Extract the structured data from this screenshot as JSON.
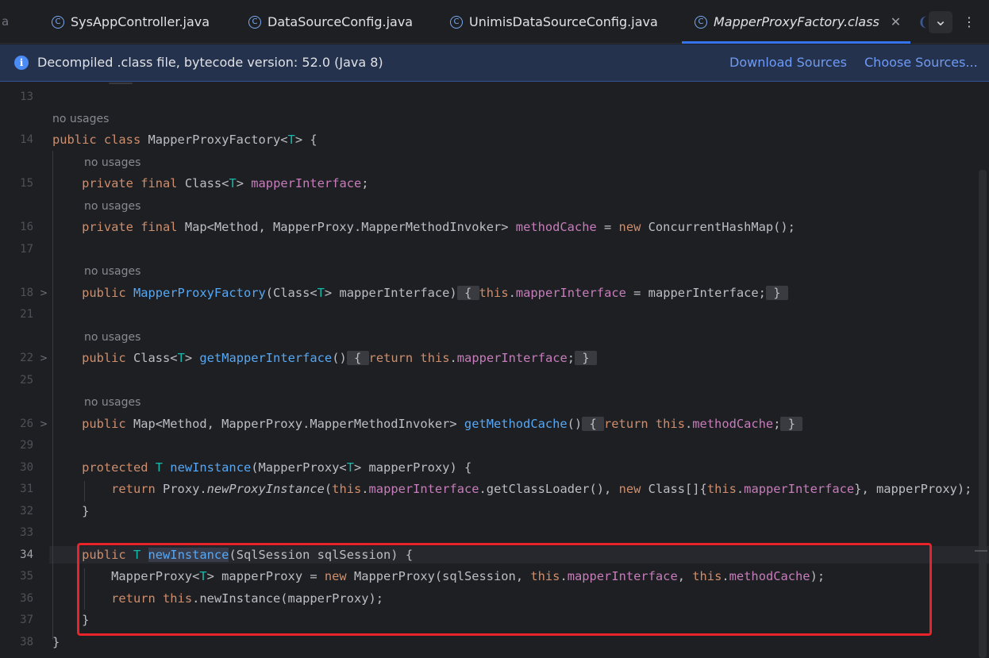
{
  "tabs": {
    "stub_left": "a",
    "items": [
      {
        "label": "SysAppController.java",
        "active": false
      },
      {
        "label": "DataSourceConfig.java",
        "active": false
      },
      {
        "label": "UnimisDataSourceConfig.java",
        "active": false
      },
      {
        "label": "MapperProxyFactory.class",
        "active": true
      }
    ],
    "class_icon_glyph": "C",
    "close_glyph": "✕",
    "overflow_glyph": "❨",
    "dropdown_glyph": "⌄",
    "more_glyph": "⋮"
  },
  "banner": {
    "info_glyph": "i",
    "text": "Decompiled .class file, bytecode version: 52.0 (Java 8)",
    "download_label": "Download Sources",
    "choose_label": "Choose Sources..."
  },
  "editor": {
    "fold_glyph": ">",
    "usage_hint": "no usages",
    "line_numbers": [
      "13",
      "14",
      "15",
      "16",
      "17",
      "18",
      "21",
      "22",
      "25",
      "26",
      "29",
      "30",
      "31",
      "32",
      "33",
      "34",
      "35",
      "36",
      "37",
      "38"
    ],
    "current_line": "34"
  },
  "colors": {
    "accent": "#3574f0",
    "highlight_box": "#e8242a",
    "keyword": "#cf8e6d",
    "field": "#c77dbb",
    "method": "#56a8f5",
    "type_param": "#16baac"
  }
}
